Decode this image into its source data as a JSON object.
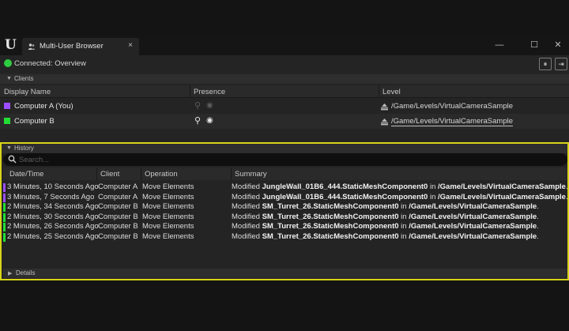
{
  "window": {
    "tab_title": "Multi-User Browser",
    "close_glyph": "×",
    "minimize_glyph": "—",
    "maximize_glyph": "☐",
    "window_close_glyph": "✕"
  },
  "connection": {
    "status": "Connected: Overview",
    "status_color": "#2ecc40",
    "pause_glyph": "⏸",
    "leave_glyph": "⇥"
  },
  "clients": {
    "section_label": "Clients",
    "columns": [
      "Display Name",
      "Presence",
      "Level"
    ],
    "rows": [
      {
        "name": "Computer A (You)",
        "color": "#9b4dff",
        "level": "/Game/Levels/VirtualCameraSample",
        "pin_icon": "location-pin-icon",
        "eye_icon": "eye-icon"
      },
      {
        "name": "Computer B",
        "color": "#22dd33",
        "level": "/Game/Levels/VirtualCameraSample",
        "pin_icon": "location-pin-icon",
        "eye_icon": "eye-icon"
      }
    ]
  },
  "history": {
    "section_label": "History",
    "search_placeholder": "Search...",
    "columns": [
      "Date/Time",
      "Client",
      "Operation",
      "Summary"
    ],
    "rows": [
      {
        "time": "3 Minutes, 10 Seconds Ago",
        "client": "Computer A",
        "color": "#9b4dff",
        "operation": "Move Elements",
        "prefix": "Modified ",
        "object": "JungleWall_01B6_444.StaticMeshComponent0",
        "mid": " in ",
        "level": "/Game/Levels/VirtualCameraSample",
        "suffix": "."
      },
      {
        "time": "3 Minutes, 7 Seconds Ago",
        "client": "Computer A",
        "color": "#9b4dff",
        "operation": "Move Elements",
        "prefix": "Modified ",
        "object": "JungleWall_01B6_444.StaticMeshComponent0",
        "mid": " in ",
        "level": "/Game/Levels/VirtualCameraSample",
        "suffix": "."
      },
      {
        "time": "2 Minutes, 34 Seconds Ago",
        "client": "Computer B",
        "color": "#22dd33",
        "operation": "Move Elements",
        "prefix": "Modified ",
        "object": "SM_Turret_26.StaticMeshComponent0",
        "mid": " in ",
        "level": "/Game/Levels/VirtualCameraSample",
        "suffix": "."
      },
      {
        "time": "2 Minutes, 30 Seconds Ago",
        "client": "Computer B",
        "color": "#22dd33",
        "operation": "Move Elements",
        "prefix": "Modified ",
        "object": "SM_Turret_26.StaticMeshComponent0",
        "mid": " in ",
        "level": "/Game/Levels/VirtualCameraSample",
        "suffix": "."
      },
      {
        "time": "2 Minutes, 26 Seconds Ago",
        "client": "Computer B",
        "color": "#22dd33",
        "operation": "Move Elements",
        "prefix": "Modified ",
        "object": "SM_Turret_26.StaticMeshComponent0",
        "mid": " in ",
        "level": "/Game/Levels/VirtualCameraSample",
        "suffix": "."
      },
      {
        "time": "2 Minutes, 25 Seconds Ago",
        "client": "Computer B",
        "color": "#22dd33",
        "operation": "Move Elements",
        "prefix": "Modified ",
        "object": "SM_Turret_26.StaticMeshComponent0",
        "mid": " in ",
        "level": "/Game/Levels/VirtualCameraSample",
        "suffix": "."
      }
    ]
  },
  "details": {
    "section_label": "Details"
  },
  "colors": {
    "highlight": "#d8d418",
    "window_bg": "#242424"
  }
}
